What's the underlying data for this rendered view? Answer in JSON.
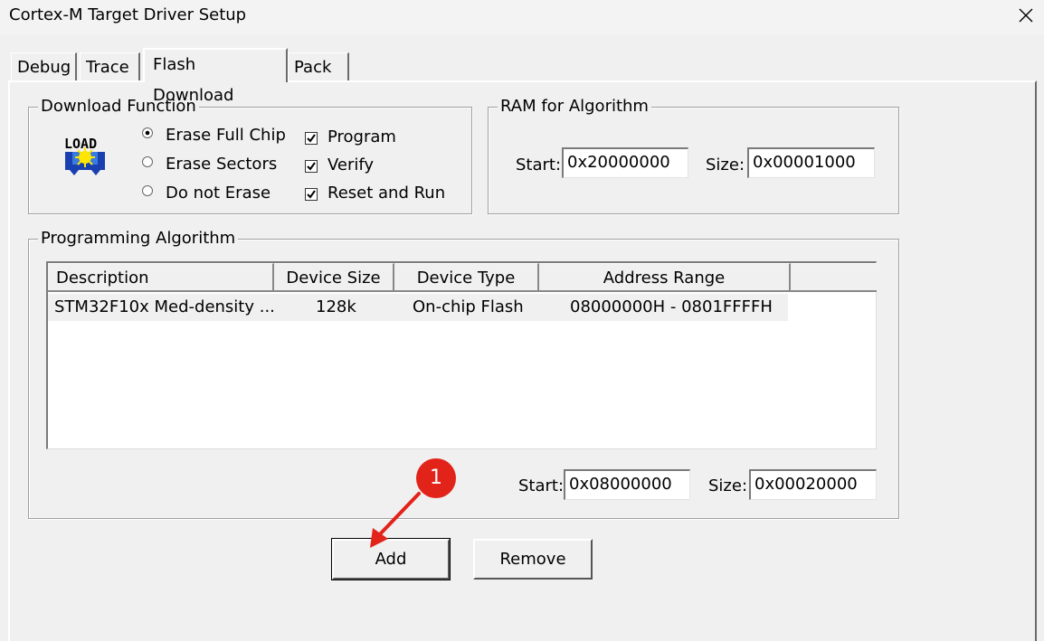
{
  "window": {
    "title": "Cortex-M Target Driver Setup"
  },
  "tabs": [
    {
      "label": "Debug"
    },
    {
      "label": "Trace"
    },
    {
      "label": "Flash Download"
    },
    {
      "label": "Pack"
    }
  ],
  "download_function": {
    "legend": "Download Function",
    "load_icon_text": "LOAD",
    "radios": [
      {
        "label": "Erase Full Chip",
        "selected": true
      },
      {
        "label": "Erase Sectors",
        "selected": false
      },
      {
        "label": "Do not Erase",
        "selected": false
      }
    ],
    "checks": [
      {
        "label": "Program",
        "checked": true
      },
      {
        "label": "Verify",
        "checked": true
      },
      {
        "label": "Reset and Run",
        "checked": true
      }
    ]
  },
  "ram": {
    "legend": "RAM for Algorithm",
    "start_label": "Start:",
    "start_value": "0x20000000",
    "size_label": "Size:",
    "size_value": "0x00001000"
  },
  "programming_algorithm": {
    "legend": "Programming Algorithm",
    "columns": [
      "Description",
      "Device Size",
      "Device Type",
      "Address Range"
    ],
    "rows": [
      [
        "STM32F10x Med-density ...",
        "128k",
        "On-chip Flash",
        "08000000H - 0801FFFFH"
      ]
    ],
    "start_label": "Start:",
    "start_value": "0x08000000",
    "size_label": "Size:",
    "size_value": "0x00020000"
  },
  "buttons": {
    "add": "Add",
    "remove": "Remove"
  },
  "annotation": {
    "badge": "1",
    "color": "#e2231a"
  }
}
